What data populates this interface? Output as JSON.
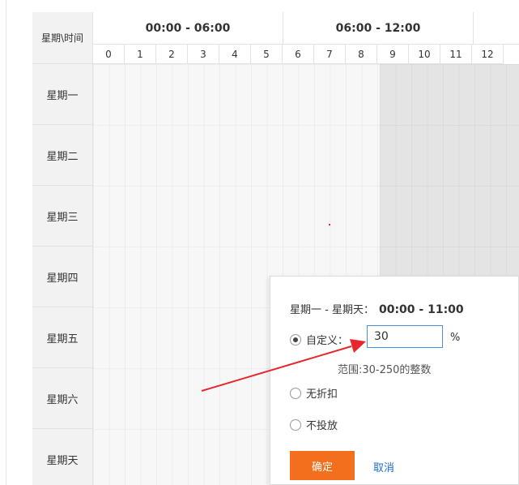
{
  "header": {
    "corner_label": "星期\\时间",
    "periods": [
      "00:00 - 06:00",
      "06:00 - 12:00"
    ],
    "hours": [
      "0",
      "1",
      "2",
      "3",
      "4",
      "5",
      "6",
      "7",
      "8",
      "9",
      "10",
      "11",
      "12"
    ]
  },
  "days": [
    "星期一",
    "星期二",
    "星期三",
    "星期四",
    "星期五",
    "星期六",
    "星期天"
  ],
  "popup": {
    "day_range": "星期一 - 星期天：",
    "time_range": "00:00 - 11:00",
    "options": {
      "custom": {
        "label": "自定义：",
        "selected": true
      },
      "no_discount": {
        "label": "无折扣",
        "selected": false
      },
      "no_delivery": {
        "label": "不投放",
        "selected": false
      }
    },
    "input_value": "30",
    "unit": "%",
    "hint": "范围:30-250的整数",
    "confirm_label": "确定",
    "cancel_label": "取消"
  },
  "colors": {
    "accent": "#f36f1d",
    "link": "#1e6fd1",
    "arrow": "#e8262b",
    "input_border": "#4a90e2"
  }
}
